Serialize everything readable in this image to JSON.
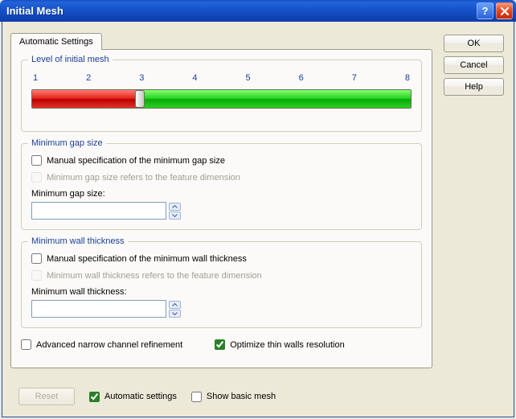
{
  "title": "Initial Mesh",
  "buttons": {
    "ok": "OK",
    "cancel": "Cancel",
    "help": "Help"
  },
  "tab": {
    "label": "Automatic Settings"
  },
  "level": {
    "legend": "Level of initial mesh",
    "scale": [
      "1",
      "2",
      "3",
      "4",
      "5",
      "6",
      "7",
      "8"
    ],
    "value": 3
  },
  "gap": {
    "legend": "Minimum gap size",
    "manual_label": "Manual specification of the minimum gap size",
    "manual_checked": false,
    "refers_label": "Minimum gap size refers to the feature dimension",
    "refers_checked": false,
    "size_label": "Minimum gap size:",
    "size_value": ""
  },
  "wall": {
    "legend": "Minimum wall thickness",
    "manual_label": "Manual specification of the minimum wall thickness",
    "manual_checked": false,
    "refers_label": "Minimum wall thickness refers to the feature dimension",
    "refers_checked": false,
    "thickness_label": "Minimum wall thickness:",
    "thickness_value": ""
  },
  "bottom": {
    "adv_label": "Advanced narrow channel refinement",
    "adv_checked": false,
    "opt_label": "Optimize thin walls resolution",
    "opt_checked": true
  },
  "footer": {
    "reset": "Reset",
    "auto_label": "Automatic settings",
    "auto_checked": true,
    "basic_label": "Show basic mesh",
    "basic_checked": false
  }
}
